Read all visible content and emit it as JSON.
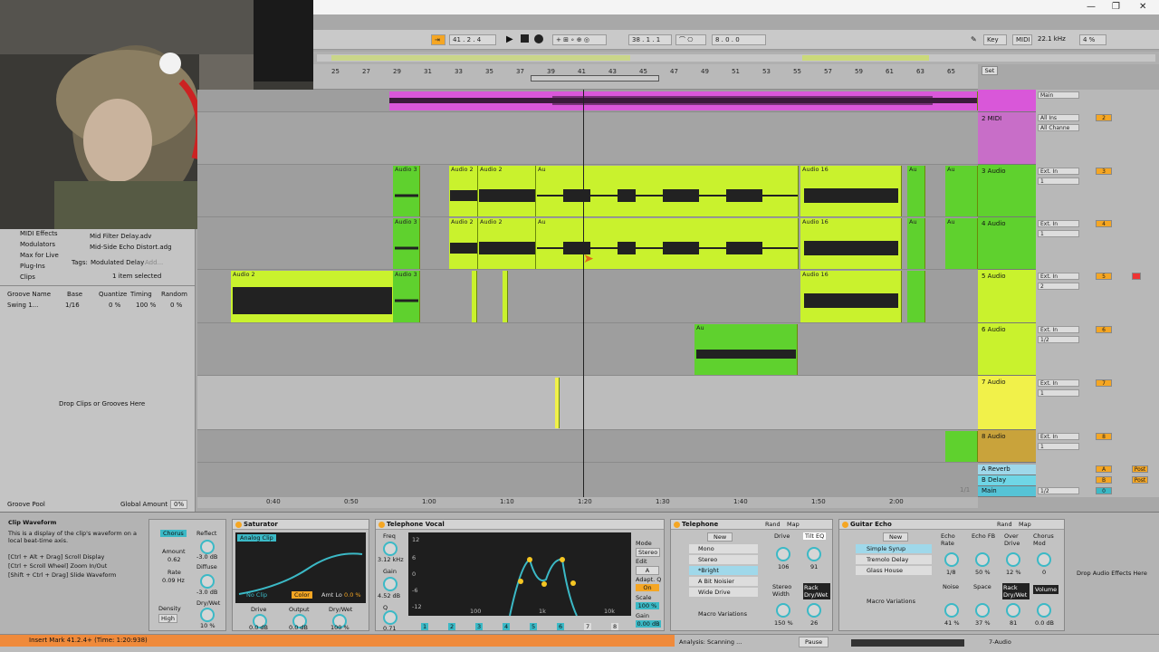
{
  "window": {
    "minimize": "—",
    "restore": "❐",
    "close": "✕"
  },
  "transport": {
    "arrangement_position": "41 .   2 .   4",
    "loop_start": "38 .   1 .   1",
    "loop_length": "8 .   0 .   0",
    "key_label": "Key",
    "midi_label": "MIDI",
    "sample_rate": "22.1 kHz",
    "cpu": "4 %"
  },
  "ruler": {
    "bars": [
      "25",
      "27",
      "29",
      "31",
      "33",
      "35",
      "37",
      "39",
      "41",
      "43",
      "45",
      "47",
      "49",
      "51",
      "53",
      "55",
      "57",
      "59",
      "61",
      "63",
      "65"
    ],
    "set_button": "Set"
  },
  "browser": {
    "categories": [
      "MIDI Effects",
      "Modulators",
      "Max for Live",
      "Plug-Ins",
      "Clips"
    ],
    "files": [
      "Mid Filter Delay.adv",
      "Mid-Side Echo Distort.adg"
    ],
    "tags_label": "Tags:",
    "tag_value": "Modulated Delay",
    "tag_add": "Add...",
    "selection": "1 item selected",
    "groove_headers": [
      "Groove Name",
      "Base",
      "Quantize",
      "Timing",
      "Random"
    ],
    "groove_row": {
      "name": "Swing 1...",
      "base": "1/16",
      "quantize": "0 %",
      "timing": "100 %",
      "random": "0 %"
    },
    "drop_hint": "Drop Clips or Grooves Here",
    "groove_pool": "Groove Pool",
    "global_amount_label": "Global Amount",
    "global_amount_value": "0%"
  },
  "tracks": [
    {
      "name": "",
      "input": "Main",
      "number": ""
    },
    {
      "name": "2 MIDI",
      "input": "All Ins",
      "channel": "All Channe",
      "number": "2"
    },
    {
      "name": "3 Audio",
      "input": "Ext. In",
      "channel": "1",
      "number": "3"
    },
    {
      "name": "4 Audio",
      "input": "Ext. In",
      "channel": "1",
      "number": "4"
    },
    {
      "name": "5 Audio",
      "input": "Ext. In",
      "channel": "2",
      "number": "5"
    },
    {
      "name": "6 Audio",
      "input": "Ext. In",
      "channel": "1/2",
      "number": "6"
    },
    {
      "name": "7 Audio",
      "input": "Ext. In",
      "channel": "1",
      "number": "7"
    },
    {
      "name": "8 Audio",
      "input": "Ext. In",
      "channel": "1",
      "number": "8"
    }
  ],
  "returns": [
    {
      "name": "A Reverb",
      "letter": "A",
      "post": "Post"
    },
    {
      "name": "B Delay",
      "letter": "B",
      "post": "Post"
    },
    {
      "name": "Main",
      "routing": "1/2",
      "value": "0"
    }
  ],
  "mixer_common": {
    "in": "In",
    "auto": "Auto",
    "off": "Off",
    "main": "Main",
    "s": "S",
    "c": "C"
  },
  "clip_names": {
    "a3": "Audio 3",
    "a2": "Audio 2",
    "a16": "Audio 16",
    "au": "Au"
  },
  "timeline": {
    "labels": [
      "0:40",
      "0:50",
      "1:00",
      "1:10",
      "1:20",
      "1:30",
      "1:40",
      "1:50",
      "2:00"
    ],
    "zoom": "1/1"
  },
  "info": {
    "title": "Clip Waveform",
    "body": "This is a display of the clip's waveform on a local beat-time axis.",
    "shortcuts": [
      "[Ctrl + Alt + Drag] Scroll Display",
      "[Ctrl + Scroll Wheel] Zoom In/Out",
      "[Shift + Ctrl + Drag] Slide Waveform"
    ]
  },
  "chorus": {
    "mode": "Chorus",
    "amount_label": "Amount",
    "amount": "0.62",
    "rate_label": "Rate",
    "rate": "0.09 Hz",
    "reflect_label": "Reflect",
    "reflect": "-3.0 dB",
    "diffuse_label": "Diffuse",
    "diffuse": "-3.0 dB",
    "density_label": "Density",
    "density": "High",
    "drywet_label": "Dry/Wet",
    "drywet": "10 %"
  },
  "saturator": {
    "title": "Saturator",
    "type": "Analog Clip",
    "no_clip": "No Clip",
    "color": "Color",
    "amt_lo_label": "Amt Lo",
    "amt_lo": "0.0 %",
    "drive_label": "Drive",
    "drive": "0.0 dB",
    "output_label": "Output",
    "output": "0.0 dB",
    "drywet_label": "Dry/Wet",
    "drywet": "100 %"
  },
  "eq": {
    "title": "Telephone Vocal",
    "freq_label": "Freq",
    "freq": "3.12 kHz",
    "gain_label": "Gain",
    "gain": "4.52 dB",
    "q_label": "Q",
    "q": "0.71",
    "db_scale": [
      "12",
      "6",
      "0",
      "-6",
      "-12"
    ],
    "freq_scale": [
      "100",
      "1k",
      "10k"
    ],
    "mode_label": "Mode",
    "mode": "Stereo",
    "edit_label": "Edit",
    "edit": "A",
    "adapt_label": "Adapt. Q",
    "adapt": "On",
    "scale_label": "Scale",
    "scale": "100 %",
    "gain_out_label": "Gain",
    "gain_out": "0.00 dB",
    "bands": [
      "1",
      "2",
      "3",
      "4",
      "5",
      "6",
      "7",
      "8"
    ]
  },
  "telephone": {
    "title": "Telephone",
    "rand": "Rand",
    "map": "Map",
    "new": "New",
    "presets": [
      "Mono",
      "Stereo",
      "*Bright",
      "A Bit Noisier",
      "Wide Drive"
    ],
    "variations": "Macro Variations",
    "drive_label": "Drive",
    "drive": "106",
    "tilt_label": "Tilt EQ",
    "tilt": "91",
    "width_label": "Stereo Width",
    "width": "150 %",
    "rack_label": "Rack Dry/Wet",
    "rack": "26"
  },
  "guitar_echo": {
    "title": "Guitar Echo",
    "rand": "Rand",
    "map": "Map",
    "new": "New",
    "presets": [
      "Simple Syrup",
      "Tremolo Delay",
      "Glass House"
    ],
    "variations": "Macro Variations",
    "knobs": [
      {
        "label": "Echo Rate",
        "value": "1/8"
      },
      {
        "label": "Echo FB",
        "value": "50 %"
      },
      {
        "label": "Over Drive",
        "value": "12 %"
      },
      {
        "label": "Chorus Mod",
        "value": "0"
      },
      {
        "label": "Noise",
        "value": "41 %"
      },
      {
        "label": "Space",
        "value": "37 %"
      },
      {
        "label": "Rack Dry/Wet",
        "value": "81"
      },
      {
        "label": "Volume",
        "value": "0.0 dB"
      }
    ]
  },
  "drop_effects": "Drop Audio Effects Here",
  "status": {
    "message": "Insert Mark 41.2.4+ (Time: 1:20:938)",
    "analysis": "Analysis: Scanning ...",
    "pause": "Pause",
    "track": "7-Audio"
  },
  "colors": {
    "magenta": "#d957d9",
    "lime": "#c9f22d",
    "green": "#5fd12e",
    "yellow": "#f1f14a",
    "orange": "#ef8a3b",
    "cyan": "#3bb9c6"
  }
}
